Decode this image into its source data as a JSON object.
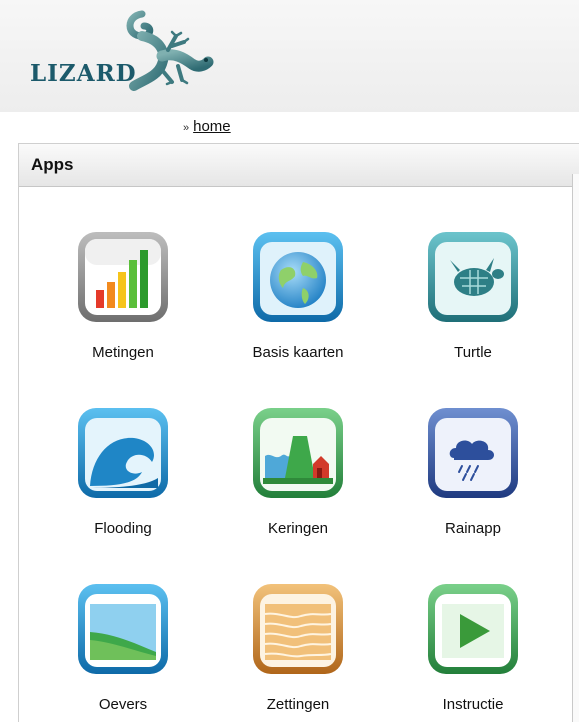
{
  "header": {
    "logo_text": "LIZARD"
  },
  "breadcrumb": {
    "separator": "»",
    "home": "home"
  },
  "panel": {
    "title": "Apps"
  },
  "apps": [
    {
      "label": "Metingen",
      "icon": "bar-chart-icon",
      "accent": "#8a8a8a"
    },
    {
      "label": "Basis kaarten",
      "icon": "globe-icon",
      "accent": "#1e88c8"
    },
    {
      "label": "Turtle",
      "icon": "turtle-icon",
      "accent": "#2a8a9a"
    },
    {
      "label": "Flooding",
      "icon": "wave-icon",
      "accent": "#1a86c4"
    },
    {
      "label": "Keringen",
      "icon": "dike-icon",
      "accent": "#2f9a45"
    },
    {
      "label": "Rainapp",
      "icon": "raincloud-icon",
      "accent": "#2d4f9c"
    },
    {
      "label": "Oevers",
      "icon": "landscape-icon",
      "accent": "#1e8cc8"
    },
    {
      "label": "Zettingen",
      "icon": "layers-icon",
      "accent": "#d98a20"
    },
    {
      "label": "Instructie",
      "icon": "play-icon",
      "accent": "#3a9a3a"
    }
  ]
}
